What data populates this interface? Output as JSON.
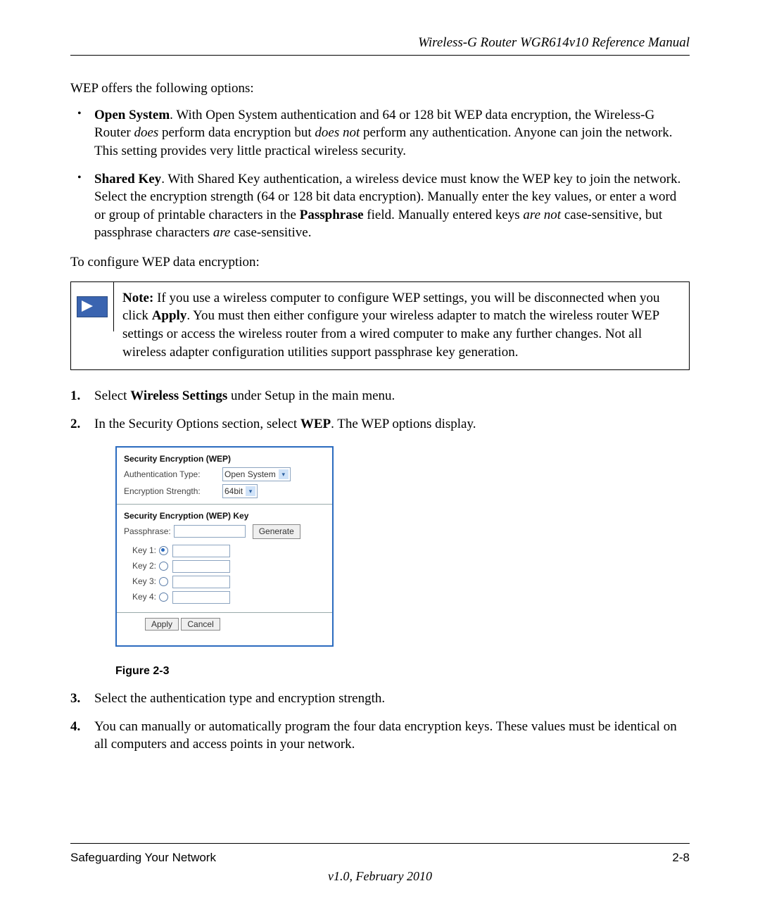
{
  "header": {
    "title": "Wireless-G Router WGR614v10 Reference Manual"
  },
  "intro": "WEP offers the following options:",
  "bullets": [
    {
      "lead": "Open System",
      "rest1": ". With Open System authentication and 64 or 128 bit WEP data encryption, the Wireless-G Router ",
      "em1": "does",
      "rest2": " perform data encryption but ",
      "em2": "does not",
      "rest3": " perform any authentication. Anyone can join the network. This setting provides very little practical wireless security."
    },
    {
      "lead": "Shared Key",
      "rest1": ". With Shared Key authentication, a wireless device must know the WEP key to join the network. Select the encryption strength (64 or 128 bit data encryption). Manually enter the key values, or enter a word or group of printable characters in the ",
      "bold1": "Passphrase",
      "rest2": " field. Manually entered keys ",
      "em1": "are not",
      "rest3": " case-sensitive, but passphrase characters ",
      "em2": "are",
      "rest4": " case-sensitive."
    }
  ],
  "configure_line": "To configure WEP data encryption:",
  "note": {
    "lead": "Note:",
    "text1": " If you use a wireless computer to configure WEP settings, you will be disconnected when you click ",
    "bold1": "Apply",
    "text2": ". You must then either configure your wireless adapter to match the wireless router WEP settings or access the wireless router from a wired computer to make any further changes. Not all wireless adapter configuration utilities support passphrase key generation."
  },
  "steps": {
    "s1_a": "Select ",
    "s1_bold": "Wireless Settings",
    "s1_b": " under Setup in the main menu.",
    "s2_a": "In the Security Options section, select ",
    "s2_bold": "WEP",
    "s2_b": ". The WEP options display.",
    "s3": "Select the authentication type and encryption strength.",
    "s4": "You can manually or automatically program the four data encryption keys. These values must be identical on all computers and access points in your network."
  },
  "panel": {
    "sec1_title": "Security Encryption (WEP)",
    "auth_label": "Authentication Type:",
    "auth_value": "Open System",
    "enc_label": "Encryption Strength:",
    "enc_value": "64bit",
    "sec2_title": "Security Encryption (WEP) Key",
    "pass_label": "Passphrase:",
    "generate": "Generate",
    "key1": "Key 1:",
    "key2": "Key 2:",
    "key3": "Key 3:",
    "key4": "Key 4:",
    "apply": "Apply",
    "cancel": "Cancel"
  },
  "figure_caption": "Figure 2-3",
  "footer": {
    "left": "Safeguarding Your Network",
    "right": "2-8",
    "version": "v1.0, February 2010"
  }
}
